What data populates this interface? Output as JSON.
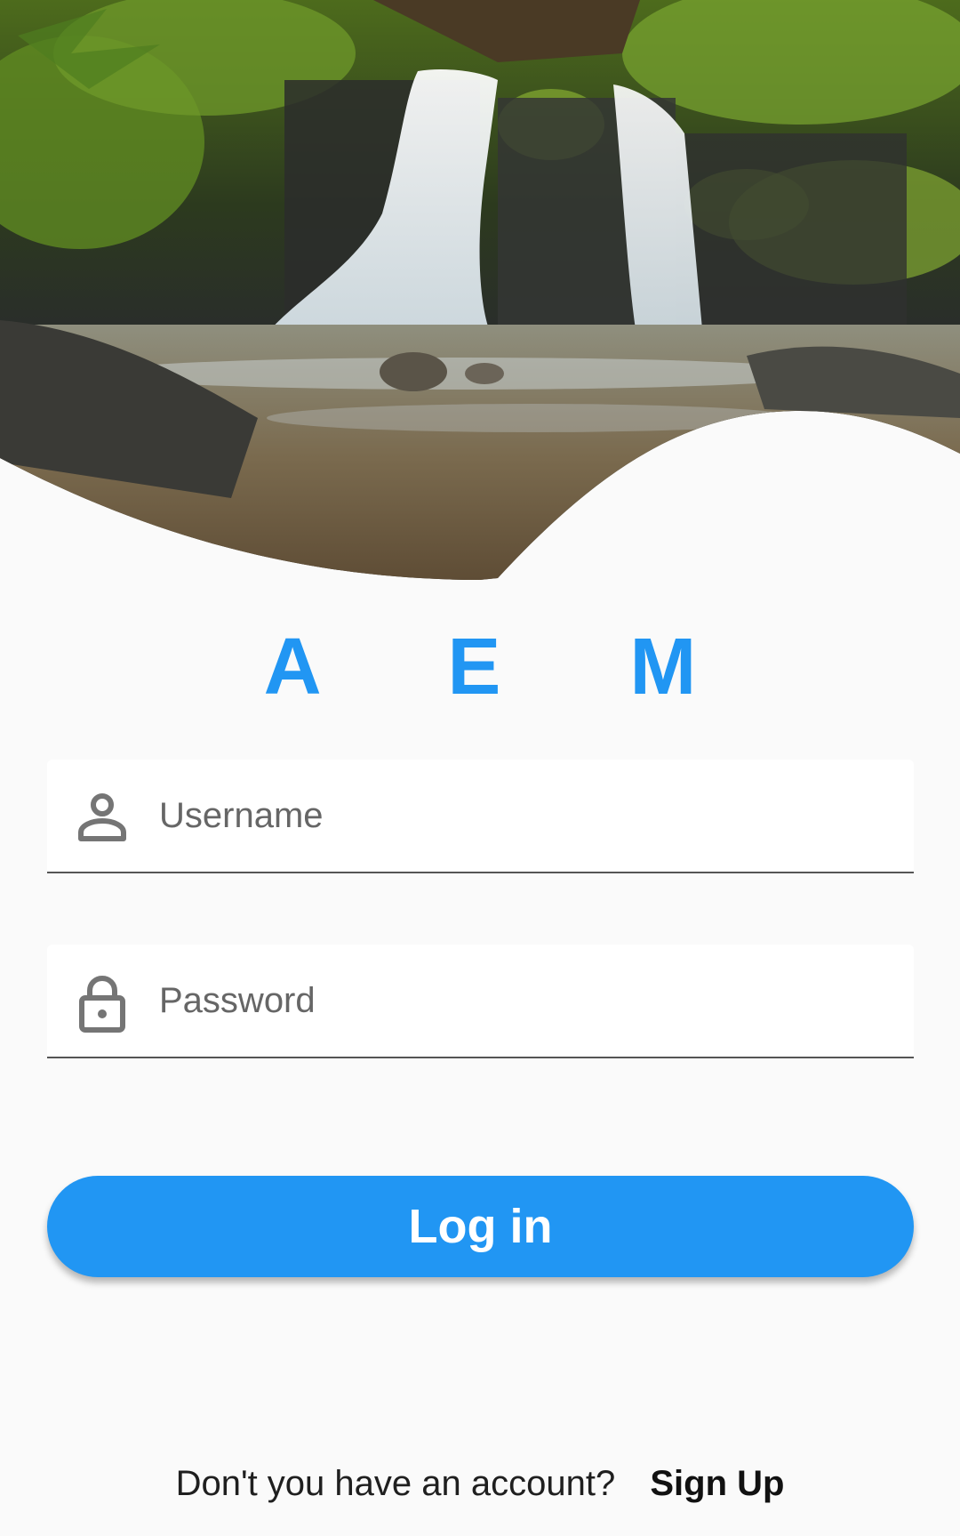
{
  "app": {
    "brand": "A E M"
  },
  "form": {
    "username": {
      "placeholder": "Username",
      "value": ""
    },
    "password": {
      "placeholder": "Password",
      "value": ""
    }
  },
  "actions": {
    "login_label": "Log in"
  },
  "footer": {
    "prompt": "Don't you have an account?",
    "signup_label": "Sign Up"
  },
  "colors": {
    "accent": "#2196f3",
    "background": "#fafafa"
  },
  "icons": {
    "username": "person-icon",
    "password": "lock-icon"
  }
}
